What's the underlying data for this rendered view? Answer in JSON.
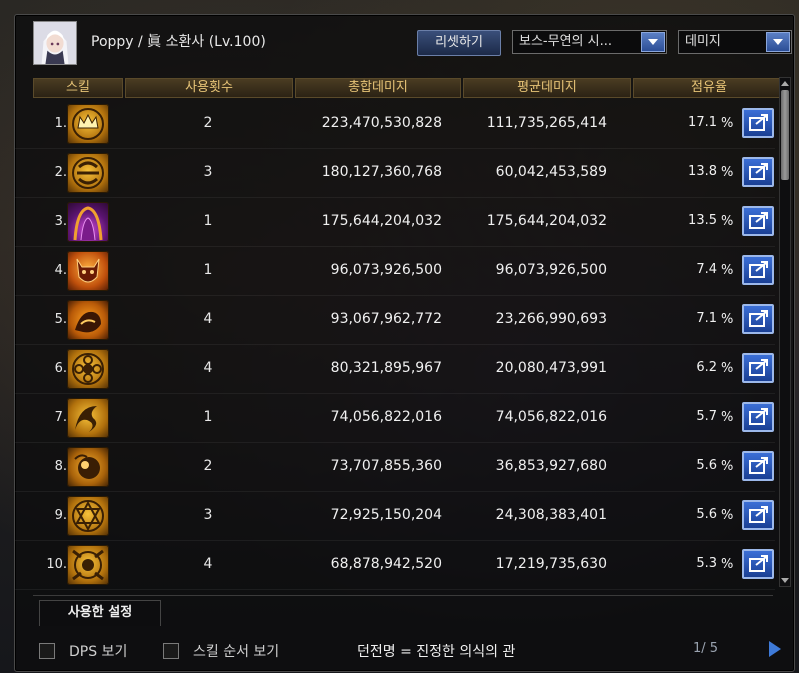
{
  "header": {
    "character_title": "Poppy / 眞 소환사 (Lv.100)",
    "reset_button": "리셋하기",
    "boss_dropdown": "보스-무연의 시...",
    "metric_dropdown": "데미지"
  },
  "columns": [
    "스킬",
    "사용횟수",
    "총합데미지",
    "평균데미지",
    "점유율"
  ],
  "rows": [
    {
      "rank": "1.",
      "icon": "crown-sigil-icon",
      "count": "2",
      "total": "223,470,530,828",
      "avg": "111,735,265,414",
      "share": "17.1",
      "pct": "%"
    },
    {
      "rank": "2.",
      "icon": "swirl-sigil-icon",
      "count": "3",
      "total": "180,127,360,768",
      "avg": "60,042,453,589",
      "share": "13.8",
      "pct": "%"
    },
    {
      "rank": "3.",
      "icon": "dark-summon-icon",
      "count": "1",
      "total": "175,644,204,032",
      "avg": "175,644,204,032",
      "share": "13.5",
      "pct": "%"
    },
    {
      "rank": "4.",
      "icon": "demon-mask-icon",
      "count": "1",
      "total": "96,073,926,500",
      "avg": "96,073,926,500",
      "share": "7.4",
      "pct": "%"
    },
    {
      "rank": "5.",
      "icon": "beast-summon-icon",
      "count": "4",
      "total": "93,067,962,772",
      "avg": "23,266,990,693",
      "share": "7.1",
      "pct": "%"
    },
    {
      "rank": "6.",
      "icon": "flower-sigil-icon",
      "count": "4",
      "total": "80,321,895,967",
      "avg": "20,080,473,991",
      "share": "6.2",
      "pct": "%"
    },
    {
      "rank": "7.",
      "icon": "spirit-swirl-icon",
      "count": "1",
      "total": "74,056,822,016",
      "avg": "74,056,822,016",
      "share": "5.7",
      "pct": "%"
    },
    {
      "rank": "8.",
      "icon": "orb-spirit-icon",
      "count": "2",
      "total": "73,707,855,360",
      "avg": "36,853,927,680",
      "share": "5.6",
      "pct": "%"
    },
    {
      "rank": "9.",
      "icon": "hexagram-sigil-icon",
      "count": "3",
      "total": "72,925,150,204",
      "avg": "24,308,383,401",
      "share": "5.6",
      "pct": "%"
    },
    {
      "rank": "10.",
      "icon": "gate-sigil-icon",
      "count": "4",
      "total": "68,878,942,520",
      "avg": "17,219,735,630",
      "share": "5.3",
      "pct": "%"
    }
  ],
  "tabs": {
    "used_settings": "사용한 설정"
  },
  "footer": {
    "dps_label": "DPS 보기",
    "skill_order_label": "스킬 순서 보기",
    "dungeon_text": "던전명 = 진정한 의식의 관",
    "page_indicator": "1/ 5"
  },
  "colors": {
    "header_text": "#e7c477",
    "accent_blue": "#3b6fd6",
    "panel_bg": "#0c0c0e"
  }
}
